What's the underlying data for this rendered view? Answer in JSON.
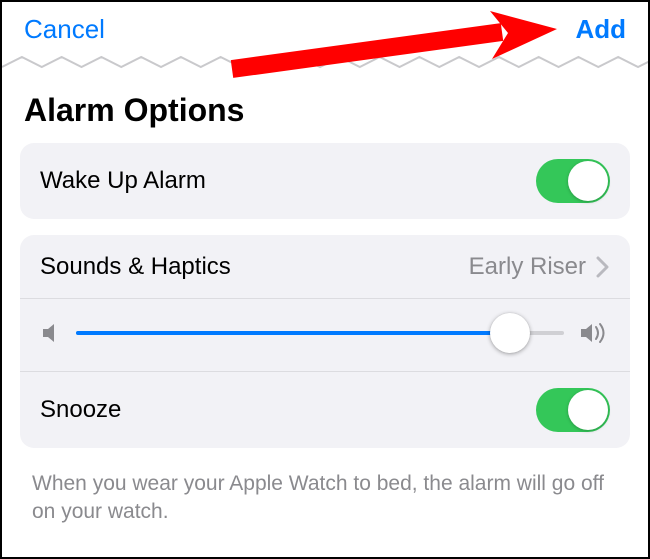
{
  "nav": {
    "cancel": "Cancel",
    "add": "Add"
  },
  "section_title": "Alarm Options",
  "rows": {
    "wake_up_label": "Wake Up Alarm",
    "sounds_label": "Sounds & Haptics",
    "sounds_value": "Early Riser",
    "snooze_label": "Snooze"
  },
  "toggles": {
    "wake_up": true,
    "snooze": true
  },
  "slider": {
    "value": 0.89
  },
  "footer": "When you wear your Apple Watch to bed, the alarm will go off on your watch.",
  "colors": {
    "accent": "#007aff",
    "toggle_on": "#34c759",
    "arrow": "#ff0000"
  }
}
